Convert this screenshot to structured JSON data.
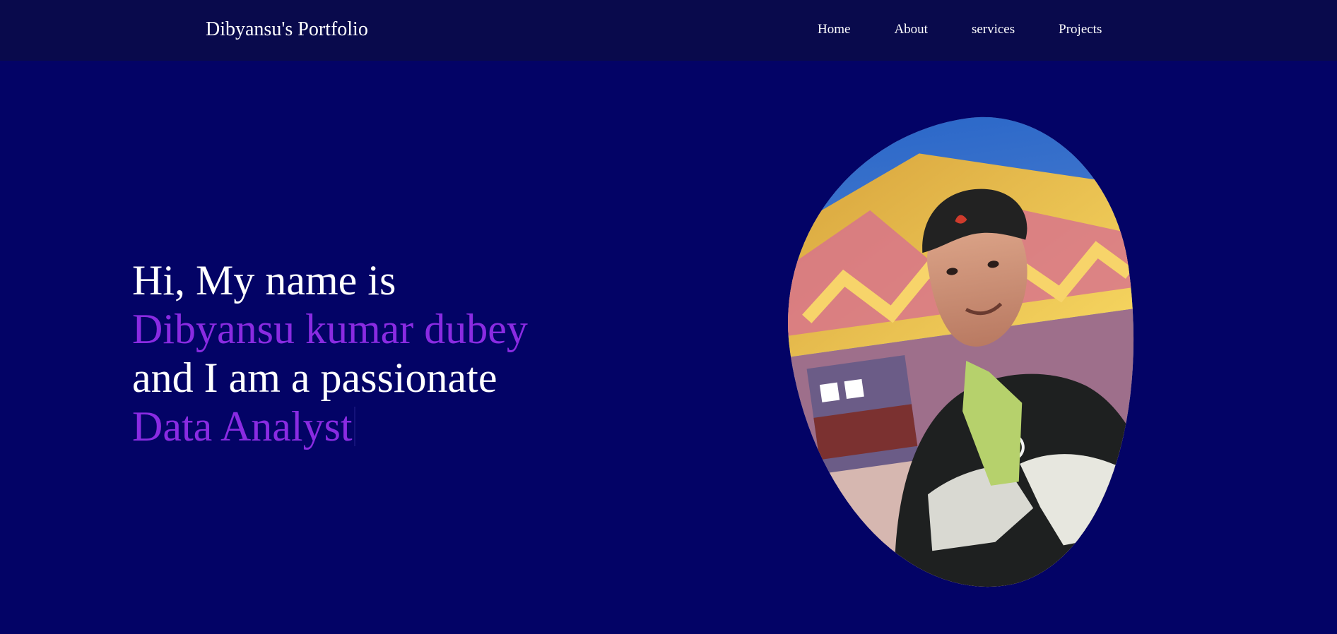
{
  "header": {
    "brand": "Dibyansu's Portfolio",
    "nav": [
      {
        "label": "Home"
      },
      {
        "label": "About"
      },
      {
        "label": "services"
      },
      {
        "label": "Projects"
      }
    ]
  },
  "hero": {
    "line1": "Hi, My name is",
    "name": "Dibyansu kumar dubey",
    "line3": "and I am a passionate",
    "role": "Data Analyst"
  },
  "colors": {
    "navbar_bg": "#090a4c",
    "hero_bg": "#030366",
    "accent": "#8a2be2",
    "text": "#ffffff"
  },
  "icons": {
    "portrait": "profile-photo"
  }
}
